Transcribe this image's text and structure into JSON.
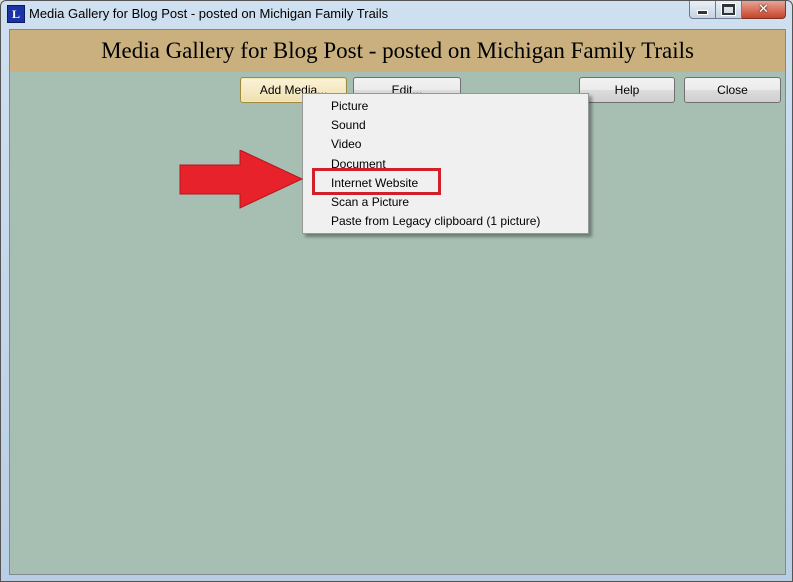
{
  "window": {
    "title": "Media Gallery for Blog Post - posted on Michigan Family Trails",
    "app_icon_letter": "L"
  },
  "header": {
    "title": "Media Gallery for Blog Post - posted on Michigan Family Trails"
  },
  "toolbar": {
    "add_media": "Add Media...",
    "edit": "Edit...",
    "help": "Help",
    "close": "Close"
  },
  "menu": {
    "items": [
      {
        "label": "Picture"
      },
      {
        "label": "Sound"
      },
      {
        "label": "Video"
      },
      {
        "label": "Document"
      },
      {
        "label": "Internet Website"
      },
      {
        "label": "Scan a Picture"
      },
      {
        "label": "Paste from Legacy clipboard (1 picture)"
      }
    ]
  },
  "colors": {
    "header_band": "#c9b07e",
    "client_bg": "#a7bfb3",
    "callout_red": "#d1202a",
    "arrow_red": "#e8222a"
  }
}
